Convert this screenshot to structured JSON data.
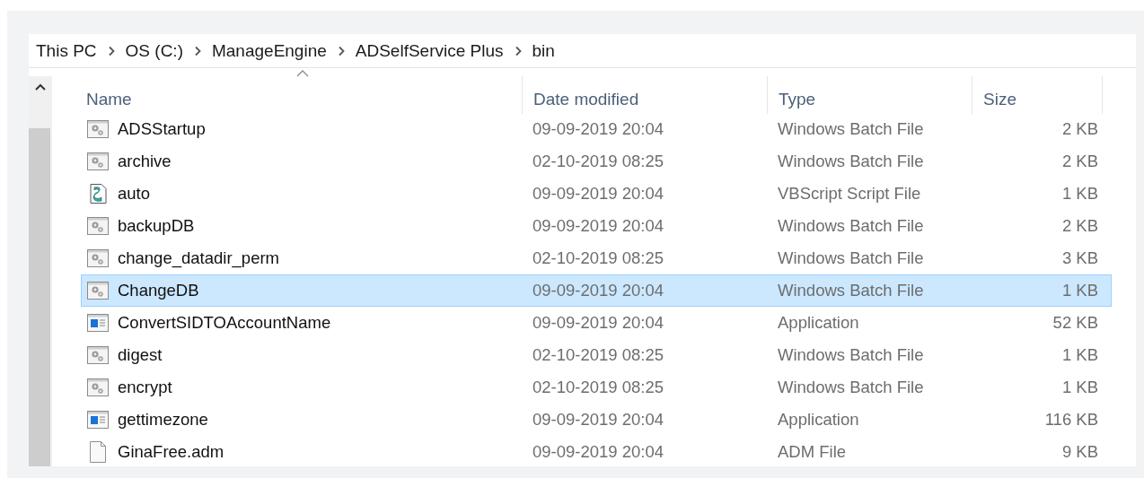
{
  "breadcrumb": [
    "This PC",
    "OS (C:)",
    "ManageEngine",
    "ADSelfService Plus",
    "bin"
  ],
  "columns": [
    {
      "label": "Name",
      "sorted": true
    },
    {
      "label": "Date modified",
      "sorted": false
    },
    {
      "label": "Type",
      "sorted": false
    },
    {
      "label": "Size",
      "sorted": false
    }
  ],
  "files": [
    {
      "name": "ADSStartup",
      "date": "09-09-2019 20:04",
      "type": "Windows Batch File",
      "size": "2 KB",
      "kind": "batch",
      "selected": false
    },
    {
      "name": "archive",
      "date": "02-10-2019 08:25",
      "type": "Windows Batch File",
      "size": "2 KB",
      "kind": "batch",
      "selected": false
    },
    {
      "name": "auto",
      "date": "09-09-2019 20:04",
      "type": "VBScript Script File",
      "size": "1 KB",
      "kind": "script",
      "selected": false
    },
    {
      "name": "backupDB",
      "date": "09-09-2019 20:04",
      "type": "Windows Batch File",
      "size": "2 KB",
      "kind": "batch",
      "selected": false
    },
    {
      "name": "change_datadir_perm",
      "date": "02-10-2019 08:25",
      "type": "Windows Batch File",
      "size": "3 KB",
      "kind": "batch",
      "selected": false
    },
    {
      "name": "ChangeDB",
      "date": "09-09-2019 20:04",
      "type": "Windows Batch File",
      "size": "1 KB",
      "kind": "batch",
      "selected": true
    },
    {
      "name": "ConvertSIDTOAccountName",
      "date": "09-09-2019 20:04",
      "type": "Application",
      "size": "52 KB",
      "kind": "app",
      "selected": false
    },
    {
      "name": "digest",
      "date": "02-10-2019 08:25",
      "type": "Windows Batch File",
      "size": "1 KB",
      "kind": "batch",
      "selected": false
    },
    {
      "name": "encrypt",
      "date": "02-10-2019 08:25",
      "type": "Windows Batch File",
      "size": "1 KB",
      "kind": "batch",
      "selected": false
    },
    {
      "name": "gettimezone",
      "date": "09-09-2019 20:04",
      "type": "Application",
      "size": "116 KB",
      "kind": "app",
      "selected": false
    },
    {
      "name": "GinaFree.adm",
      "date": "09-09-2019 20:04",
      "type": "ADM File",
      "size": "9 KB",
      "kind": "file",
      "selected": false
    }
  ]
}
